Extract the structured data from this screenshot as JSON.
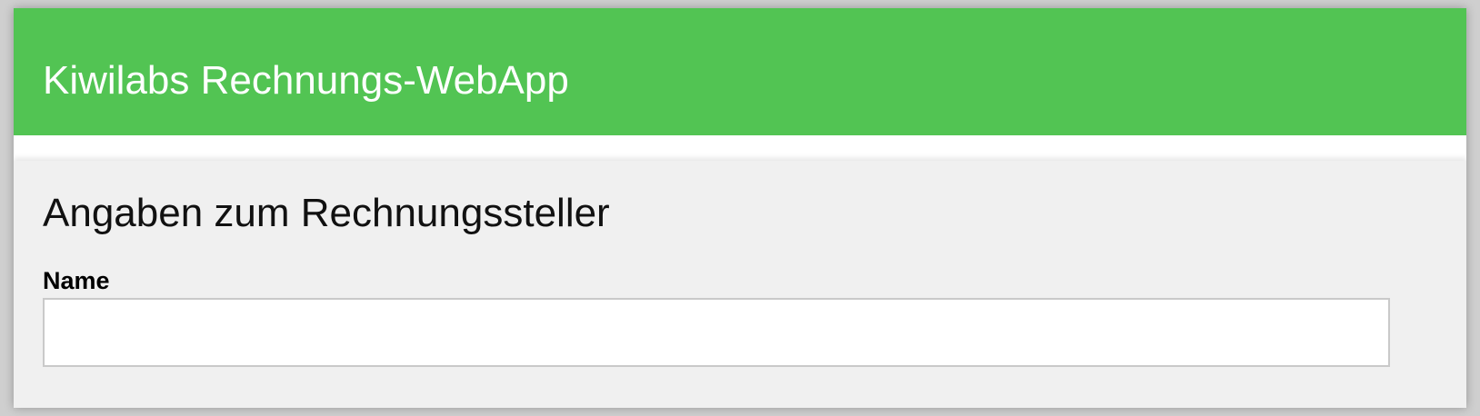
{
  "colors": {
    "header_background": "#52c453",
    "header_text": "#ffffff",
    "section_background": "#f0f0f0",
    "input_border": "#c9c9c9"
  },
  "header": {
    "title": "Kiwilabs Rechnungs-WebApp"
  },
  "invoice_issuer_section": {
    "title": "Angaben zum Rechnungssteller",
    "name_field": {
      "label": "Name",
      "value": "",
      "placeholder": ""
    }
  }
}
